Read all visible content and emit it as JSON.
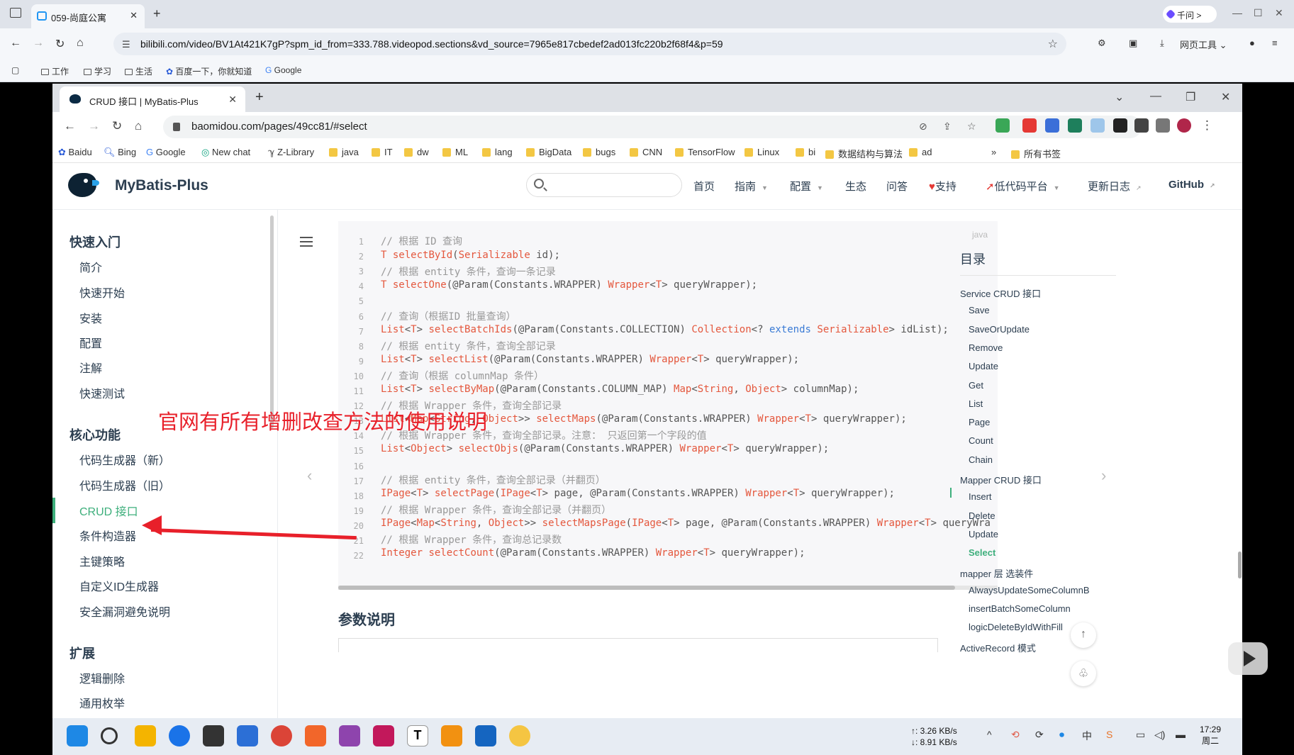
{
  "outer_browser": {
    "tab_title": "059-尚庭公寓",
    "qianwen_label": "千问 >",
    "url": "bilibili.com/video/BV1At421K7gP?spm_id_from=333.788.videopod.sections&vd_source=7965e817cbedef2ad013fc220b2f68f4&p=59",
    "web_tools_label": "网页工具",
    "bookmarks": [
      "工作",
      "学习",
      "生活",
      "百度一下，你就知道",
      "Google"
    ]
  },
  "inner_browser": {
    "tab_title": "CRUD 接口 | MyBatis-Plus",
    "url": "baomidou.com/pages/49cc81/#select",
    "bookmarks": [
      {
        "label": "Baidu",
        "icon": "paw-icon"
      },
      {
        "label": "Bing",
        "icon": "search-icon"
      },
      {
        "label": "Google",
        "icon": "google-icon"
      },
      {
        "label": "New chat",
        "icon": "chat-icon"
      },
      {
        "label": "Z-Library",
        "icon": "book-icon"
      },
      {
        "label": "java",
        "icon": "folder-icon"
      },
      {
        "label": "IT",
        "icon": "folder-icon"
      },
      {
        "label": "dw",
        "icon": "folder-icon"
      },
      {
        "label": "ML",
        "icon": "folder-icon"
      },
      {
        "label": "lang",
        "icon": "folder-icon"
      },
      {
        "label": "BigData",
        "icon": "folder-icon"
      },
      {
        "label": "bugs",
        "icon": "folder-icon"
      },
      {
        "label": "CNN",
        "icon": "folder-icon"
      },
      {
        "label": "TensorFlow",
        "icon": "folder-icon"
      },
      {
        "label": "Linux",
        "icon": "folder-icon"
      },
      {
        "label": "bi",
        "icon": "folder-icon"
      },
      {
        "label": "数据结构与算法",
        "icon": "folder-icon"
      },
      {
        "label": "ad",
        "icon": "folder-icon"
      }
    ],
    "more_bookmarks": "»",
    "all_bookmarks": "所有书签"
  },
  "site": {
    "name": "MyBatis-Plus",
    "nav": [
      "首页",
      "指南",
      "配置",
      "生态",
      "问答",
      "支持",
      "低代码平台",
      "更新日志",
      "GitHub"
    ]
  },
  "sidebar": {
    "sections": [
      {
        "title": "快速入门",
        "items": [
          "简介",
          "快速开始",
          "安装",
          "配置",
          "注解",
          "快速测试"
        ]
      },
      {
        "title": "核心功能",
        "items": [
          "代码生成器（新）",
          "代码生成器（旧）",
          "CRUD 接口",
          "条件构造器",
          "主键策略",
          "自定义ID生成器",
          "安全漏洞避免说明"
        ]
      },
      {
        "title": "扩展",
        "items": [
          "逻辑删除",
          "通用枚举"
        ]
      }
    ],
    "active_item": "CRUD 接口"
  },
  "code": {
    "language": "java",
    "line_numbers": [
      "1",
      "2",
      "3",
      "4",
      "5",
      "6",
      "7",
      "8",
      "9",
      "10",
      "11",
      "12",
      "13",
      "14",
      "15",
      "16",
      "17",
      "18",
      "19",
      "20",
      "21",
      "22"
    ]
  },
  "annotation": "官网有所有增删改查方法的使用说明",
  "params_heading": "参数说明",
  "toc": {
    "title": "目录",
    "items": [
      {
        "label": "Service CRUD 接口",
        "level": 1
      },
      {
        "label": "Save",
        "level": 2
      },
      {
        "label": "SaveOrUpdate",
        "level": 2
      },
      {
        "label": "Remove",
        "level": 2
      },
      {
        "label": "Update",
        "level": 2
      },
      {
        "label": "Get",
        "level": 2
      },
      {
        "label": "List",
        "level": 2
      },
      {
        "label": "Page",
        "level": 2
      },
      {
        "label": "Count",
        "level": 2
      },
      {
        "label": "Chain",
        "level": 2
      },
      {
        "label": "Mapper CRUD 接口",
        "level": 1
      },
      {
        "label": "Insert",
        "level": 2
      },
      {
        "label": "Delete",
        "level": 2
      },
      {
        "label": "Update",
        "level": 2
      },
      {
        "label": "Select",
        "level": 2,
        "active": true
      },
      {
        "label": "mapper 层 选装件",
        "level": 1
      },
      {
        "label": "AlwaysUpdateSomeColumnB",
        "level": 2
      },
      {
        "label": "insertBatchSomeColumn",
        "level": 2
      },
      {
        "label": "logicDeleteByIdWithFill",
        "level": 2
      },
      {
        "label": "ActiveRecord 模式",
        "level": 1
      }
    ]
  },
  "taskbar": {
    "upload_speed": "↑: 3.26 KB/s",
    "download_speed": "↓: 8.91 KB/s",
    "time": "17:29",
    "weekday": "周二",
    "ime": "中"
  },
  "colors": {
    "accent": "#3eaf7c",
    "annotation_red": "#e8202a",
    "code_keyword": "#e4573d",
    "code_comment": "#999999"
  }
}
